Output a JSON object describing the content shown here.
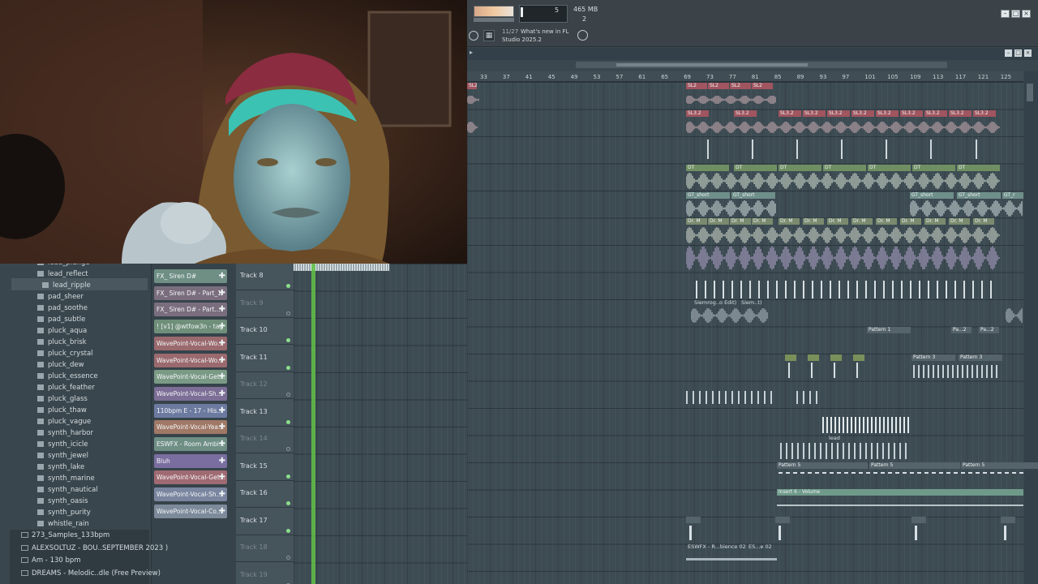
{
  "toolbar": {
    "mem_number": "5",
    "mem_label": "465 MB",
    "mem_number2": "2",
    "news_count": "11/27",
    "news_line1": "What's new in FL",
    "news_line2": "Studio 2025.2"
  },
  "ruler_ticks": [
    "33",
    "37",
    "41",
    "45",
    "49",
    "53",
    "57",
    "61",
    "65",
    "69",
    "73",
    "77",
    "81",
    "85",
    "89",
    "93",
    "97",
    "101",
    "105",
    "109",
    "113",
    "117",
    "121",
    "125"
  ],
  "tracks": [
    {
      "label": "Track 8",
      "dim": false
    },
    {
      "label": "Track 9",
      "dim": true
    },
    {
      "label": "Track 10",
      "dim": false
    },
    {
      "label": "Track 11",
      "dim": false
    },
    {
      "label": "Track 12",
      "dim": true
    },
    {
      "label": "Track 13",
      "dim": false
    },
    {
      "label": "Track 14",
      "dim": true
    },
    {
      "label": "Track 15",
      "dim": false
    },
    {
      "label": "Track 16",
      "dim": false
    },
    {
      "label": "Track 17",
      "dim": false
    },
    {
      "label": "Track 18",
      "dim": true
    },
    {
      "label": "Track 19",
      "dim": true
    }
  ],
  "picker": [
    {
      "label": "FX_ Siren D#",
      "color": "#6f8f85"
    },
    {
      "label": "FX_ Siren D# - Part_1",
      "color": "#7a6e7e"
    },
    {
      "label": "FX_ Siren D# - Part...",
      "color": "#7a6e7e"
    },
    {
      "label": "! [v1] @wtfow3n - tag",
      "color": "#6f8f7a"
    },
    {
      "label": "WavePoint-Vocal-Wo...",
      "color": "#9a6a6e"
    },
    {
      "label": "WavePoint-Vocal-Wo...",
      "color": "#9a6a6e"
    },
    {
      "label": "WavePoint-Vocal-Get...",
      "color": "#7a9a86"
    },
    {
      "label": "WavePoint-Vocal-Sh...",
      "color": "#7c6e96"
    },
    {
      "label": "110bpm E - 17 - His...",
      "color": "#6d7aa0"
    },
    {
      "label": "WavePoint-Vocal-Yea...",
      "color": "#a07866"
    },
    {
      "label": "ESWFX - Room Ambi...",
      "color": "#6f8f85"
    },
    {
      "label": "Bluh",
      "color": "#7a6ea0"
    },
    {
      "label": "WavePoint-Vocal-Get...",
      "color": "#a06a72"
    },
    {
      "label": "WavePoint-Vocal-Sh...",
      "color": "#7a86a0"
    },
    {
      "label": "WavePoint-Vocal-Co...",
      "color": "#7c8a9a"
    }
  ],
  "browser": {
    "items": [
      "lead_plunge",
      "lead_reflect",
      "lead_ripple",
      "pad_sheer",
      "pad_soothe",
      "pad_subtle",
      "pluck_aqua",
      "pluck_brisk",
      "pluck_crystal",
      "pluck_dew",
      "pluck_essence",
      "pluck_feather",
      "pluck_glass",
      "pluck_thaw",
      "pluck_vague",
      "synth_harbor",
      "synth_icicle",
      "synth_jewel",
      "synth_lake",
      "synth_marine",
      "synth_nautical",
      "synth_oasis",
      "synth_purity",
      "whistle_rain"
    ],
    "selected": "lead_ripple",
    "folders": [
      "273_Samples_133bpm",
      "ALEXSOLTUZ - BOU..SEPTEMBER 2023 )",
      "Am - 130 bpm",
      "DREAMS - Melodic..dle (Free Preview)"
    ]
  },
  "clips": {
    "sl2": "SL2",
    "sl32": "SL3.2",
    "dt": "DT",
    "gt_short": "GT_short",
    "gt_r": "GT_r",
    "dr_m": "Dr. M",
    "track9_clip1": "Siemrog..o Edit)",
    "track9_clip2": "Siem..t)",
    "pattern1": "Pattern 1",
    "pa2": "Pa...2",
    "pattern3": "Pattern 3",
    "pattern5": "Pattern 5",
    "lead": "lead",
    "insert6": "Insert 6 - Volume",
    "eswfx1": "ESWFX - R...bience 02",
    "eswfx2": "ES...e 02"
  }
}
